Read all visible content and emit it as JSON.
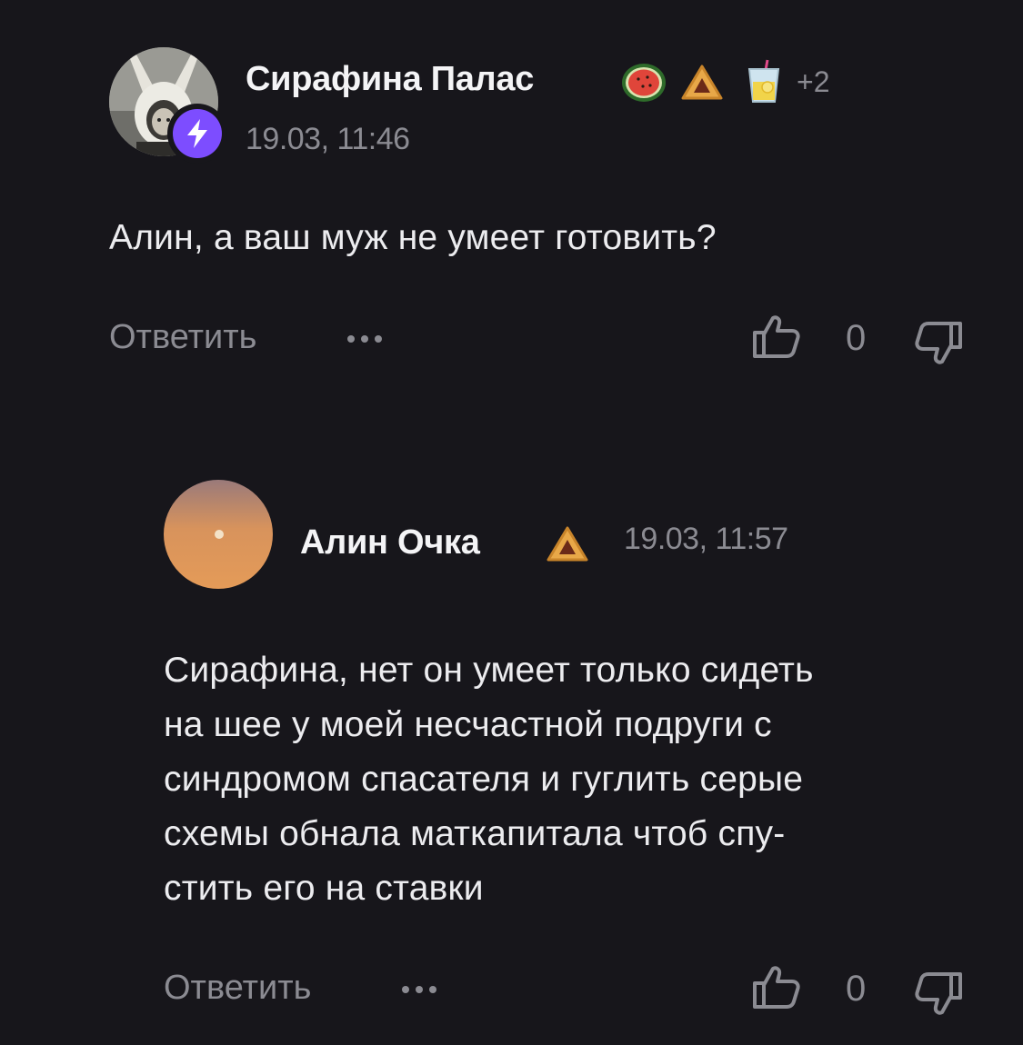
{
  "comments": [
    {
      "author": "Сирафина Палас",
      "timestamp": "19.03, 11:46",
      "extra_badges": "+2",
      "text": "Алин, а ваш муж не умеет готовить?",
      "reply_label": "Ответить",
      "vote_count": "0",
      "avatar": "photo-avatar",
      "badge_icon": "lightning-icon",
      "badge_color": "#7d4dff",
      "emoji_badges": [
        "watermelon-icon",
        "hamantash-icon",
        "lemonade-icon"
      ]
    },
    {
      "author": "Алин Очка",
      "timestamp": "19.03, 11:57",
      "text_lines": [
        "Сирафина, нет он умеет только сидеть",
        "на шее у моей несчастной подруги с",
        "синдромом спасателя и гуглить серые",
        "схемы обнала маткапитала чтоб спу-",
        "стить его на ставки"
      ],
      "reply_label": "Ответить",
      "vote_count": "0",
      "avatar": "moon-gradient-avatar",
      "emoji_badges": [
        "hamantash-icon"
      ]
    }
  ],
  "colors": {
    "background": "#17161b",
    "text_primary": "#f4f4f6",
    "text_secondary": "#8b8b92",
    "accent": "#7d4dff"
  }
}
